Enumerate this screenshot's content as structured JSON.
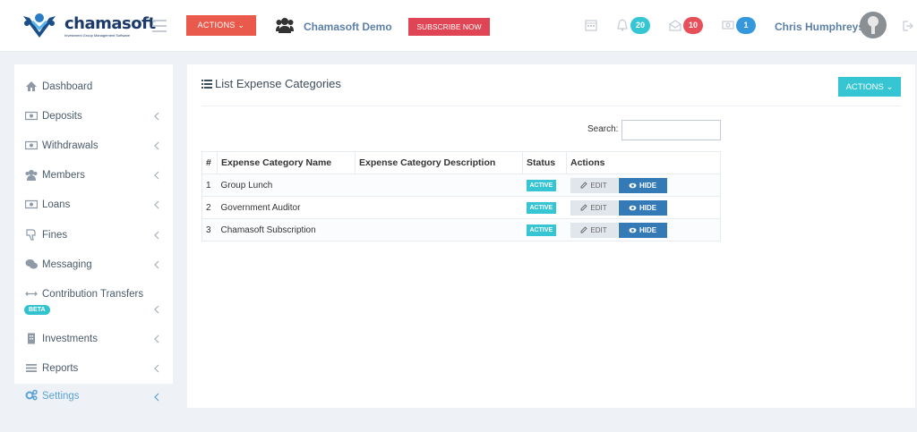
{
  "header": {
    "logo_name": "chamasoft",
    "logo_tagline": "Investment Group Management Software",
    "actions_label": "ACTIONS",
    "group_name": "Chamasoft Demo",
    "subscribe_label": "SUBSCRIBE NOW",
    "notifications_count": "20",
    "messages_count": "10",
    "wallet_count": "1",
    "user_name": "Chris Humphreys",
    "colors": {
      "actions": "#ea5a4c",
      "subscribe": "#e04555",
      "teal": "#36c6d3",
      "red_badge": "#e7505a",
      "blue_badge": "#3598dc"
    }
  },
  "sidebar": {
    "items": [
      {
        "label": "Dashboard",
        "icon": "home-icon"
      },
      {
        "label": "Deposits",
        "icon": "money-icon"
      },
      {
        "label": "Withdrawals",
        "icon": "money-icon"
      },
      {
        "label": "Members",
        "icon": "users-icon"
      },
      {
        "label": "Loans",
        "icon": "money-icon"
      },
      {
        "label": "Fines",
        "icon": "thumbs-down-icon"
      },
      {
        "label": "Messaging",
        "icon": "comments-icon"
      },
      {
        "label": "Contribution Transfers",
        "icon": "arrows-h-icon"
      },
      {
        "label": "Investments",
        "icon": "building-icon"
      },
      {
        "label": "Reports",
        "icon": "bars-icon"
      },
      {
        "label": "Settings",
        "icon": "cogs-icon"
      }
    ],
    "beta_label": "BETA",
    "active_item": "Settings"
  },
  "main": {
    "title": "List Expense Categories",
    "actions_label": "ACTIONS",
    "search_label": "Search:",
    "search_value": "",
    "table": {
      "headers": [
        "#",
        "Expense Category Name",
        "Expense Category Description",
        "Status",
        "Actions"
      ],
      "rows": [
        {
          "num": "1",
          "name": "Group Lunch",
          "description": "",
          "status": "ACTIVE",
          "edit": "EDIT",
          "hide": "HIDE"
        },
        {
          "num": "2",
          "name": "Government Auditor",
          "description": "",
          "status": "ACTIVE",
          "edit": "EDIT",
          "hide": "HIDE"
        },
        {
          "num": "3",
          "name": "Chamasoft Subscription",
          "description": "",
          "status": "ACTIVE",
          "edit": "EDIT",
          "hide": "HIDE"
        }
      ]
    }
  }
}
